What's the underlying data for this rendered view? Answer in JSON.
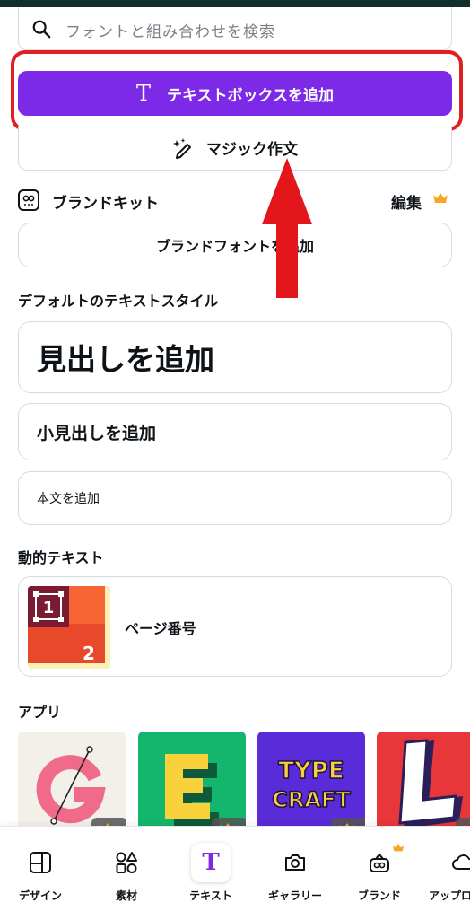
{
  "search": {
    "placeholder": "フォントと組み合わせを検索"
  },
  "add_textbox": {
    "label": "テキストボックスを追加",
    "icon": "text-T-icon"
  },
  "magic_write": {
    "label": "マジック作文",
    "icon": "magic-pen-icon"
  },
  "brand_kit": {
    "title": "ブランドキット",
    "edit": "編集",
    "icon": "brand-kit-icon"
  },
  "brand_font": {
    "label": "ブランドフォントを追加"
  },
  "default_styles": {
    "title": "デフォルトのテキストスタイル",
    "heading": "見出しを追加",
    "subheading": "小見出しを追加",
    "body": "本文を追加"
  },
  "dynamic_text": {
    "title": "動的テキスト",
    "item_label": "ページ番号",
    "thumb_numbers": [
      "1",
      "2"
    ]
  },
  "apps": {
    "title": "アプリ",
    "items": [
      {
        "name": "G-logo-app"
      },
      {
        "name": "E-letter-app"
      },
      {
        "name": "typecraft-app",
        "text": [
          "TYPE",
          "CRAFT"
        ]
      },
      {
        "name": "L-letter-app"
      }
    ]
  },
  "bottom_nav": [
    {
      "label": "デザイン",
      "icon": "design-layout-icon"
    },
    {
      "label": "素材",
      "icon": "elements-shapes-icon"
    },
    {
      "label": "テキスト",
      "icon": "text-T-icon",
      "active": true
    },
    {
      "label": "ギャラリー",
      "icon": "camera-icon"
    },
    {
      "label": "ブランド",
      "icon": "brand-icon"
    },
    {
      "label": "アップロ",
      "icon": "upload-cloud-icon"
    }
  ],
  "colors": {
    "accent": "#7d2ae8",
    "highlight": "#e02020",
    "crown": "#f5a623"
  }
}
